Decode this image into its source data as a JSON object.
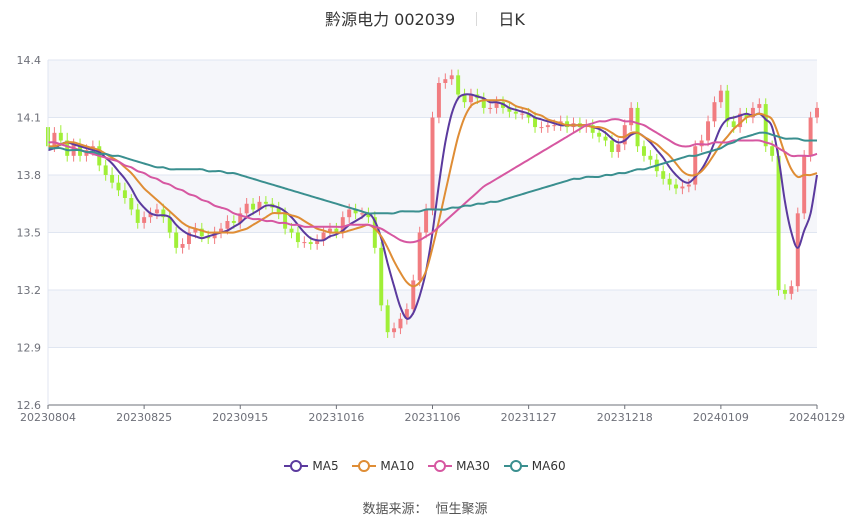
{
  "header": {
    "title": "黔源电力 002039",
    "subtitle": "日K"
  },
  "source": {
    "label": "数据来源：",
    "value": "恒生聚源"
  },
  "colors": {
    "up": "#f17c80",
    "down": "#a0ef37",
    "grid": "#e0e6f1",
    "band": "#f5f6fa",
    "axis": "#6e7079"
  },
  "chart_data": {
    "type": "candlestick",
    "ylim": [
      12.6,
      14.4
    ],
    "yticks": [
      "14.4",
      "14.1",
      "13.8",
      "13.5",
      "13.2",
      "12.9",
      "12.6"
    ],
    "xtick_labels": [
      "20230804",
      "20230825",
      "20230915",
      "20231016",
      "20231106",
      "20231127",
      "20231218",
      "20240109",
      "20240129"
    ],
    "grid": true,
    "legend_position": "bottom",
    "series_styles": [
      {
        "name": "MA5",
        "color": "#5b3a9e"
      },
      {
        "name": "MA10",
        "color": "#df8d35"
      },
      {
        "name": "MA30",
        "color": "#d657a1"
      },
      {
        "name": "MA60",
        "color": "#3a8f8f"
      }
    ],
    "candles": {
      "open": [
        14.05,
        13.95,
        14.02,
        13.98,
        13.9,
        13.96,
        13.9,
        13.93,
        13.95,
        13.85,
        13.8,
        13.76,
        13.72,
        13.68,
        13.62,
        13.55,
        13.58,
        13.6,
        13.62,
        13.58,
        13.5,
        13.42,
        13.44,
        13.5,
        13.52,
        13.48,
        13.47,
        13.5,
        13.52,
        13.56,
        13.55,
        13.6,
        13.65,
        13.62,
        13.66,
        13.65,
        13.63,
        13.6,
        13.52,
        13.5,
        13.45,
        13.45,
        13.44,
        13.46,
        13.5,
        13.52,
        13.5,
        13.58,
        13.62,
        13.6,
        13.6,
        13.58,
        13.42,
        13.12,
        12.98,
        13.0,
        13.05,
        13.1,
        13.25,
        13.5,
        13.62,
        14.1,
        14.28,
        14.3,
        14.32,
        14.22,
        14.18,
        14.22,
        14.2,
        14.15,
        14.15,
        14.18,
        14.15,
        14.13,
        14.12,
        14.12,
        14.1,
        14.05,
        14.05,
        14.06,
        14.06,
        14.08,
        14.05,
        14.07,
        14.05,
        14.06,
        14.02,
        14.0,
        13.98,
        13.92,
        13.96,
        14.06,
        14.15,
        13.95,
        13.9,
        13.88,
        13.82,
        13.78,
        13.75,
        13.73,
        13.74,
        13.75,
        13.95,
        13.98,
        14.08,
        14.18,
        14.24,
        14.08,
        14.05,
        14.12,
        14.1,
        14.15,
        14.17,
        13.95,
        13.9,
        13.2,
        13.18,
        13.22,
        13.6,
        13.9,
        14.1
      ],
      "close": [
        13.95,
        14.02,
        13.98,
        13.9,
        13.96,
        13.9,
        13.93,
        13.95,
        13.85,
        13.8,
        13.76,
        13.72,
        13.68,
        13.62,
        13.55,
        13.58,
        13.6,
        13.62,
        13.58,
        13.5,
        13.42,
        13.44,
        13.5,
        13.52,
        13.48,
        13.47,
        13.5,
        13.52,
        13.56,
        13.55,
        13.6,
        13.65,
        13.62,
        13.66,
        13.65,
        13.63,
        13.6,
        13.52,
        13.5,
        13.45,
        13.45,
        13.44,
        13.46,
        13.5,
        13.52,
        13.5,
        13.58,
        13.62,
        13.6,
        13.6,
        13.58,
        13.42,
        13.12,
        12.98,
        13.0,
        13.05,
        13.1,
        13.25,
        13.5,
        13.62,
        14.1,
        14.28,
        14.3,
        14.32,
        14.22,
        14.18,
        14.22,
        14.2,
        14.15,
        14.15,
        14.18,
        14.15,
        14.13,
        14.12,
        14.12,
        14.1,
        14.05,
        14.05,
        14.06,
        14.06,
        14.08,
        14.05,
        14.07,
        14.05,
        14.06,
        14.02,
        14.0,
        13.98,
        13.92,
        13.96,
        14.06,
        14.15,
        13.95,
        13.9,
        13.88,
        13.82,
        13.78,
        13.75,
        13.73,
        13.74,
        13.75,
        13.95,
        13.98,
        14.08,
        14.18,
        14.24,
        14.08,
        14.05,
        14.12,
        14.1,
        14.15,
        14.17,
        13.95,
        13.9,
        13.2,
        13.18,
        13.22,
        13.6,
        13.9,
        14.1,
        14.15
      ],
      "high": [
        14.1,
        14.05,
        14.06,
        14.02,
        13.99,
        13.99,
        13.96,
        13.98,
        13.98,
        13.88,
        13.84,
        13.8,
        13.76,
        13.7,
        13.65,
        13.61,
        13.63,
        13.65,
        13.65,
        13.61,
        13.53,
        13.47,
        13.53,
        13.55,
        13.55,
        13.51,
        13.53,
        13.55,
        13.59,
        13.59,
        13.63,
        13.68,
        13.68,
        13.69,
        13.69,
        13.68,
        13.66,
        13.63,
        13.55,
        13.53,
        13.48,
        13.48,
        13.49,
        13.53,
        13.55,
        13.55,
        13.61,
        13.65,
        13.65,
        13.63,
        13.63,
        13.61,
        13.45,
        13.15,
        13.03,
        13.08,
        13.13,
        13.28,
        13.53,
        13.65,
        14.13,
        14.31,
        14.33,
        14.35,
        14.35,
        14.25,
        14.25,
        14.25,
        14.23,
        14.18,
        14.21,
        14.21,
        14.18,
        14.16,
        14.15,
        14.15,
        14.13,
        14.08,
        14.09,
        14.09,
        14.11,
        14.11,
        14.1,
        14.1,
        14.09,
        14.09,
        14.05,
        14.03,
        14.01,
        13.99,
        14.09,
        14.18,
        14.18,
        13.98,
        13.93,
        13.91,
        13.85,
        13.81,
        13.78,
        13.77,
        13.78,
        13.98,
        14.01,
        14.11,
        14.21,
        14.27,
        14.27,
        14.11,
        14.15,
        14.15,
        14.18,
        14.2,
        14.2,
        13.98,
        13.93,
        13.23,
        13.25,
        13.63,
        13.93,
        14.13,
        14.18
      ],
      "low": [
        13.92,
        13.92,
        13.95,
        13.87,
        13.87,
        13.87,
        13.87,
        13.9,
        13.82,
        13.77,
        13.73,
        13.69,
        13.65,
        13.59,
        13.52,
        13.52,
        13.55,
        13.57,
        13.55,
        13.47,
        13.39,
        13.39,
        13.41,
        13.47,
        13.45,
        13.44,
        13.44,
        13.47,
        13.49,
        13.52,
        13.52,
        13.57,
        13.59,
        13.59,
        13.62,
        13.6,
        13.57,
        13.49,
        13.47,
        13.42,
        13.42,
        13.41,
        13.41,
        13.43,
        13.47,
        13.47,
        13.47,
        13.55,
        13.57,
        13.57,
        13.55,
        13.39,
        13.09,
        12.95,
        12.95,
        12.97,
        13.02,
        13.07,
        13.22,
        13.47,
        13.59,
        14.07,
        14.25,
        14.27,
        14.19,
        14.15,
        14.15,
        14.17,
        14.12,
        14.12,
        14.12,
        14.12,
        14.1,
        14.09,
        14.09,
        14.07,
        14.02,
        14.02,
        14.02,
        14.03,
        14.03,
        14.02,
        14.02,
        14.02,
        14.02,
        13.99,
        13.97,
        13.95,
        13.89,
        13.89,
        13.93,
        14.03,
        13.92,
        13.87,
        13.85,
        13.79,
        13.75,
        13.72,
        13.7,
        13.7,
        13.71,
        13.72,
        13.92,
        13.95,
        14.05,
        14.15,
        14.05,
        14.02,
        14.02,
        14.07,
        14.07,
        14.12,
        13.92,
        13.87,
        13.17,
        13.15,
        13.15,
        13.19,
        13.57,
        13.87,
        14.07
      ]
    },
    "series": [
      {
        "name": "MA5",
        "values": [
          13.93,
          13.94,
          13.96,
          13.97,
          13.96,
          13.95,
          13.94,
          13.93,
          13.92,
          13.89,
          13.86,
          13.82,
          13.78,
          13.73,
          13.67,
          13.63,
          13.6,
          13.59,
          13.59,
          13.58,
          13.54,
          13.51,
          13.49,
          13.48,
          13.47,
          13.48,
          13.49,
          13.5,
          13.51,
          13.53,
          13.55,
          13.58,
          13.6,
          13.62,
          13.64,
          13.64,
          13.63,
          13.61,
          13.58,
          13.54,
          13.5,
          13.47,
          13.46,
          13.46,
          13.48,
          13.49,
          13.51,
          13.54,
          13.56,
          13.58,
          13.6,
          13.56,
          13.47,
          13.34,
          13.22,
          13.11,
          13.05,
          13.08,
          13.17,
          13.3,
          13.5,
          13.75,
          13.97,
          14.12,
          14.2,
          14.22,
          14.22,
          14.21,
          14.2,
          14.18,
          14.18,
          14.17,
          14.15,
          14.14,
          14.13,
          14.12,
          14.1,
          14.09,
          14.08,
          14.07,
          14.06,
          14.06,
          14.06,
          14.06,
          14.06,
          14.05,
          14.04,
          14.02,
          13.99,
          13.97,
          13.98,
          14.01,
          14.02,
          14.0,
          13.97,
          13.93,
          13.89,
          13.84,
          13.8,
          13.77,
          13.76,
          13.79,
          13.83,
          13.89,
          13.97,
          14.05,
          14.09,
          14.1,
          14.11,
          14.12,
          14.11,
          14.12,
          14.09,
          14.05,
          13.89,
          13.66,
          13.5,
          13.42,
          13.51,
          13.6,
          13.8
        ]
      },
      {
        "name": "MA10",
        "values": [
          13.95,
          13.95,
          13.96,
          13.97,
          13.97,
          13.96,
          13.95,
          13.94,
          13.93,
          13.91,
          13.89,
          13.87,
          13.84,
          13.81,
          13.77,
          13.73,
          13.7,
          13.67,
          13.64,
          13.61,
          13.58,
          13.55,
          13.53,
          13.52,
          13.51,
          13.5,
          13.5,
          13.5,
          13.5,
          13.5,
          13.51,
          13.52,
          13.54,
          13.56,
          13.58,
          13.6,
          13.6,
          13.6,
          13.59,
          13.58,
          13.56,
          13.54,
          13.52,
          13.51,
          13.5,
          13.5,
          13.5,
          13.51,
          13.52,
          13.53,
          13.54,
          13.52,
          13.48,
          13.42,
          13.35,
          13.29,
          13.24,
          13.22,
          13.24,
          13.3,
          13.42,
          13.56,
          13.71,
          13.86,
          14.0,
          14.1,
          14.16,
          14.18,
          14.19,
          14.19,
          14.19,
          14.19,
          14.18,
          14.16,
          14.15,
          14.14,
          14.12,
          14.11,
          14.09,
          14.08,
          14.07,
          14.06,
          14.06,
          14.06,
          14.06,
          14.05,
          14.05,
          14.04,
          14.02,
          14.0,
          14.0,
          14.02,
          14.02,
          14.0,
          13.98,
          13.96,
          13.93,
          13.9,
          13.86,
          13.82,
          13.8,
          13.8,
          13.82,
          13.86,
          13.91,
          13.96,
          14.0,
          14.04,
          14.07,
          14.1,
          14.11,
          14.12,
          14.11,
          14.09,
          14.01,
          13.91,
          13.83,
          13.79,
          13.8,
          13.8,
          13.81
        ]
      },
      {
        "name": "MA30",
        "values": [
          13.97,
          13.97,
          13.96,
          13.95,
          13.94,
          13.93,
          13.92,
          13.91,
          13.9,
          13.89,
          13.88,
          13.87,
          13.85,
          13.84,
          13.82,
          13.81,
          13.79,
          13.78,
          13.76,
          13.75,
          13.73,
          13.72,
          13.7,
          13.69,
          13.67,
          13.66,
          13.64,
          13.63,
          13.62,
          13.6,
          13.59,
          13.58,
          13.57,
          13.57,
          13.56,
          13.56,
          13.55,
          13.55,
          13.54,
          13.54,
          13.53,
          13.53,
          13.53,
          13.53,
          13.53,
          13.53,
          13.53,
          13.54,
          13.54,
          13.54,
          13.54,
          13.53,
          13.52,
          13.5,
          13.48,
          13.46,
          13.45,
          13.45,
          13.46,
          13.48,
          13.5,
          13.53,
          13.56,
          13.59,
          13.62,
          13.65,
          13.68,
          13.71,
          13.74,
          13.76,
          13.78,
          13.8,
          13.82,
          13.84,
          13.86,
          13.88,
          13.9,
          13.92,
          13.94,
          13.96,
          13.98,
          14.0,
          14.02,
          14.04,
          14.06,
          14.07,
          14.08,
          14.08,
          14.09,
          14.09,
          14.08,
          14.08,
          14.07,
          14.06,
          14.04,
          14.02,
          14.0,
          13.98,
          13.96,
          13.95,
          13.95,
          13.96,
          13.96,
          13.96,
          13.97,
          13.97,
          13.97,
          13.98,
          13.98,
          13.98,
          13.98,
          13.98,
          13.97,
          13.96,
          13.94,
          13.92,
          13.9,
          13.9,
          13.9,
          13.9,
          13.91
        ]
      },
      {
        "name": "MA60",
        "values": [
          13.94,
          13.94,
          13.94,
          13.93,
          13.93,
          13.93,
          13.92,
          13.92,
          13.91,
          13.91,
          13.9,
          13.9,
          13.89,
          13.88,
          13.87,
          13.86,
          13.85,
          13.84,
          13.84,
          13.83,
          13.83,
          13.83,
          13.83,
          13.83,
          13.83,
          13.82,
          13.82,
          13.82,
          13.81,
          13.81,
          13.8,
          13.79,
          13.78,
          13.77,
          13.76,
          13.75,
          13.74,
          13.73,
          13.72,
          13.71,
          13.7,
          13.69,
          13.68,
          13.67,
          13.66,
          13.65,
          13.64,
          13.63,
          13.62,
          13.61,
          13.6,
          13.6,
          13.6,
          13.6,
          13.6,
          13.61,
          13.61,
          13.61,
          13.61,
          13.62,
          13.62,
          13.62,
          13.62,
          13.63,
          13.63,
          13.64,
          13.64,
          13.65,
          13.65,
          13.66,
          13.66,
          13.67,
          13.68,
          13.69,
          13.7,
          13.71,
          13.72,
          13.73,
          13.74,
          13.75,
          13.76,
          13.77,
          13.78,
          13.78,
          13.79,
          13.79,
          13.79,
          13.8,
          13.8,
          13.81,
          13.81,
          13.82,
          13.83,
          13.83,
          13.84,
          13.85,
          13.86,
          13.87,
          13.88,
          13.89,
          13.9,
          13.9,
          13.91,
          13.92,
          13.93,
          13.94,
          13.96,
          13.97,
          13.99,
          14.0,
          14.01,
          14.02,
          14.02,
          14.01,
          14.0,
          13.99,
          13.99,
          13.99,
          13.98,
          13.98,
          13.98
        ]
      }
    ]
  }
}
